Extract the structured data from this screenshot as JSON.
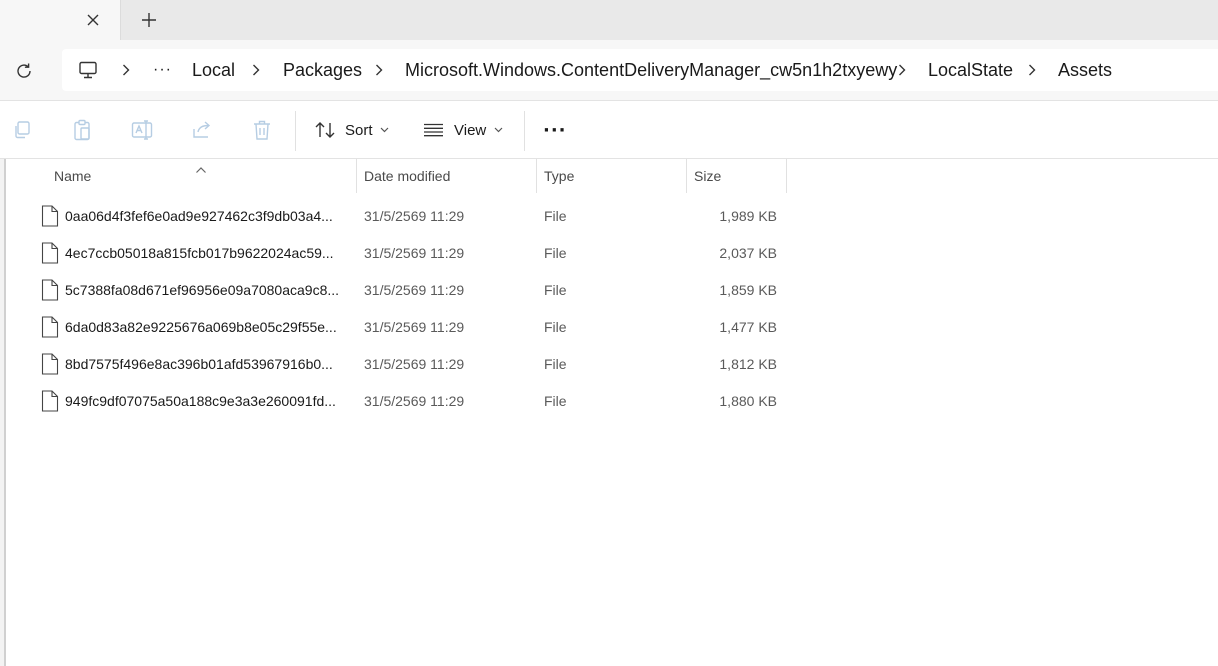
{
  "tabs": {
    "close_icon": "close-icon",
    "new_tab_icon": "plus-icon"
  },
  "navigation": {
    "refresh_icon": "refresh-icon",
    "breadcrumb": {
      "root_icon": "computer-icon",
      "overflow": "···",
      "items": [
        "Local",
        "Packages",
        "Microsoft.Windows.ContentDeliveryManager_cw5n1h2txyewy",
        "LocalState",
        "Assets"
      ]
    }
  },
  "toolbar": {
    "copy_icon": "copy-icon",
    "paste_icon": "paste-icon",
    "rename_icon": "rename-icon",
    "share_icon": "share-icon",
    "delete_icon": "delete-icon",
    "sort_label": "Sort",
    "view_label": "View",
    "more_label": "···"
  },
  "columns": {
    "name": "Name",
    "date": "Date modified",
    "type": "Type",
    "size": "Size",
    "sorted_by": "Name"
  },
  "files": [
    {
      "name": "0aa06d4f3fef6e0ad9e927462c3f9db03a4...",
      "date": "31/5/2569 11:29",
      "type": "File",
      "size": "1,989 KB"
    },
    {
      "name": "4ec7ccb05018a815fcb017b9622024ac59...",
      "date": "31/5/2569 11:29",
      "type": "File",
      "size": "2,037 KB"
    },
    {
      "name": "5c7388fa08d671ef96956e09a7080aca9c8...",
      "date": "31/5/2569 11:29",
      "type": "File",
      "size": "1,859 KB"
    },
    {
      "name": "6da0d83a82e9225676a069b8e05c29f55e...",
      "date": "31/5/2569 11:29",
      "type": "File",
      "size": "1,477 KB"
    },
    {
      "name": "8bd7575f496e8ac396b01afd53967916b0...",
      "date": "31/5/2569 11:29",
      "type": "File",
      "size": "1,812 KB"
    },
    {
      "name": "949fc9df07075a50a188c9e3a3e260091fd...",
      "date": "31/5/2569 11:29",
      "type": "File",
      "size": "1,880 KB"
    }
  ],
  "colors": {
    "window_bg": "#ffffff",
    "chrome_bg": "#f7f7f7",
    "tabstrip_bg": "#e9e9e9",
    "disabled_icon": "#b6cde3",
    "text_secondary": "#5a5a5a"
  }
}
